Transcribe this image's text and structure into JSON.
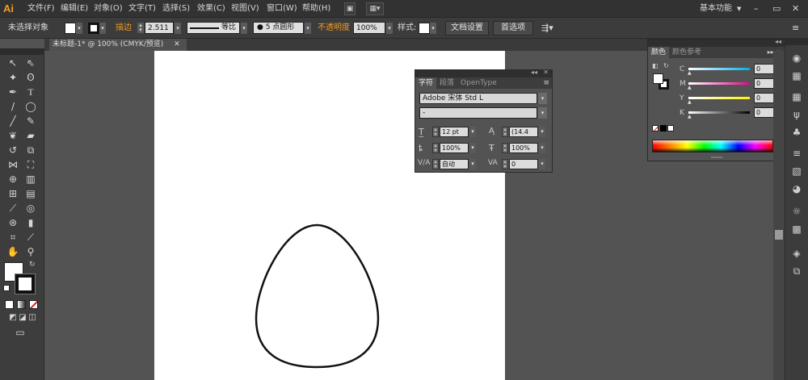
{
  "app": {
    "logo": "Ai",
    "workspace": "基本功能"
  },
  "menu": {
    "items": [
      "文件(F)",
      "编辑(E)",
      "对象(O)",
      "文字(T)",
      "选择(S)",
      "效果(C)",
      "视图(V)",
      "窗口(W)",
      "帮助(H)"
    ]
  },
  "options": {
    "no_selection": "未选择对象",
    "stroke_label": "描边",
    "stroke_value": "2.511",
    "profile_label": "等比",
    "brush_label": "● 5 点圆形",
    "opacity_label": "不透明度",
    "opacity_value": "100%",
    "style_label": "样式:",
    "doc_setup": "文档设置",
    "preferences": "首选项"
  },
  "document": {
    "tab_title": "未标题-1* @ 100% (CMYK/预览)"
  },
  "character_panel": {
    "tabs": [
      "字符",
      "段落",
      "OpenType"
    ],
    "font_family": "Adobe 宋体 Std L",
    "font_style": "-",
    "font_size": "12 pt",
    "leading": "(14.4",
    "vertical_scale": "100%",
    "horizontal_scale": "100%",
    "kerning": "自动",
    "tracking": "0"
  },
  "color_panel": {
    "tabs": [
      "颜色",
      "颜色参考"
    ],
    "channels": [
      {
        "label": "C",
        "value": "0",
        "unit": "%"
      },
      {
        "label": "M",
        "value": "0",
        "unit": "%"
      },
      {
        "label": "Y",
        "value": "0",
        "unit": "%"
      },
      {
        "label": "K",
        "value": "0",
        "unit": "%"
      }
    ]
  },
  "colors": {
    "accent_orange": "#f49a22",
    "canvas": "#ffffff",
    "workspace_bg": "#535353"
  }
}
